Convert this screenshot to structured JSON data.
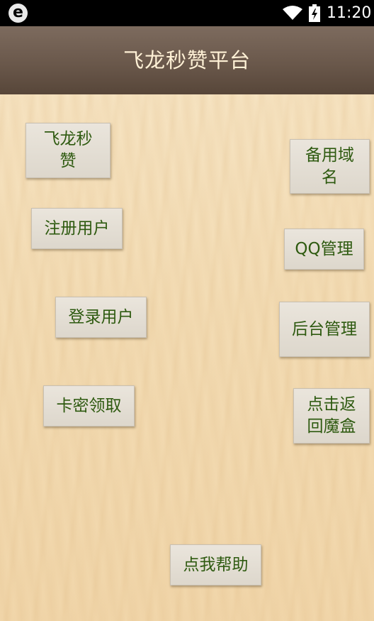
{
  "status_bar": {
    "app_logo": "e",
    "time": "11:20",
    "icons": [
      "wifi-icon",
      "battery-charging-icon"
    ]
  },
  "header": {
    "title": "飞龙秒赞平台"
  },
  "buttons": {
    "feilong_miaozan": "飞龙秒赞",
    "backup_domain": "备用域名",
    "register_user": "注册用户",
    "qq_manage": "QQ管理",
    "login_user": "登录用户",
    "backend_manage": "后台管理",
    "card_code": "卡密领取",
    "return_magic_box": "点击返回魔盒",
    "help": "点我帮助"
  },
  "colors": {
    "button_text": "#2e5a10",
    "title_bar": "#6a584b",
    "title_text": "#fff1d6",
    "background": "#f2dcb6"
  }
}
